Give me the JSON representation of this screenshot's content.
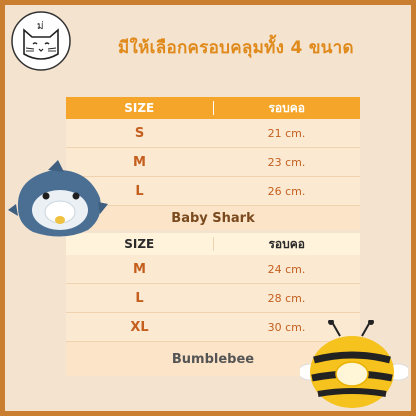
{
  "headline": "มีให้เลือกครอบคลุมทั้ง 4 ขนาด",
  "logo_text": "ม่",
  "table1": {
    "col_size": "SIZE",
    "col_value": "รอบคอ",
    "rows": [
      {
        "size": "S",
        "value": "21 cm."
      },
      {
        "size": "M",
        "value": "23 cm."
      },
      {
        "size": "L",
        "value": "26 cm."
      }
    ],
    "name": "Baby Shark"
  },
  "table2": {
    "col_size": "SIZE",
    "col_value": "รอบคอ",
    "rows": [
      {
        "size": "M",
        "value": "24 cm."
      },
      {
        "size": "L",
        "value": "28 cm."
      },
      {
        "size": "XL",
        "value": "30 cm."
      }
    ],
    "name": "Bumblebee"
  },
  "colors": {
    "background": "#f3e3cf",
    "border": "#c97f2f",
    "accent": "#f5a62a",
    "headline": "#e08a1c"
  }
}
